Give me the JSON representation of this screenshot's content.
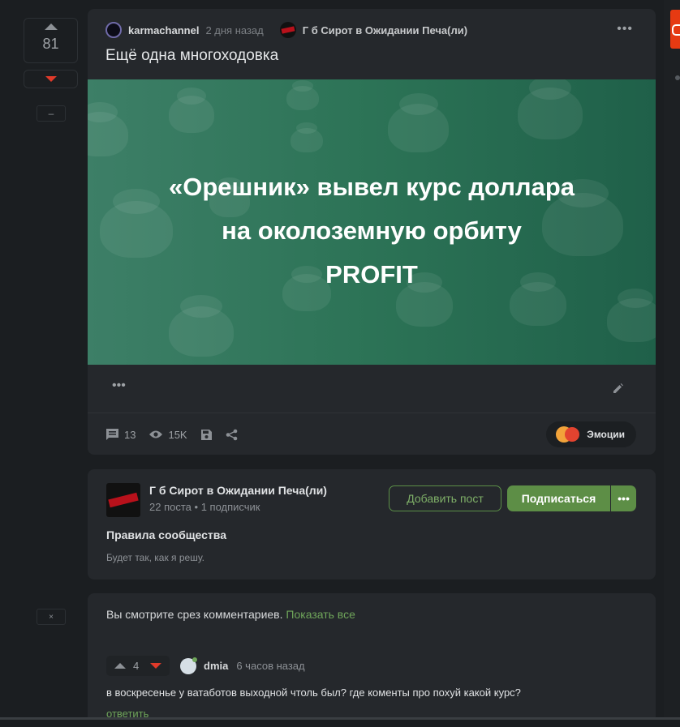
{
  "rail": {
    "rating": "81",
    "collapse_label": "–",
    "close_label": "×"
  },
  "post": {
    "author": "karmachannel",
    "time": "2 дня назад",
    "community": "Г б Сирот в Ожидании Печа(ли)",
    "title": "Ещё одна многоходовка",
    "banner_lines": [
      "«Орешник» вывел курс доллара",
      "на околоземную орбиту",
      "PROFIT"
    ],
    "comments_count": "13",
    "views": "15K",
    "emotions_label": "Эмоции"
  },
  "community": {
    "name": "Г б Сирот в Ожидании Печа(ли)",
    "posts": "22 поста",
    "subscribers": "1 подписчик",
    "add_post": "Добавить пост",
    "subscribe": "Подписаться",
    "rules_title": "Правила сообщества",
    "rules_text": "Будет так, как я решу."
  },
  "comments": {
    "slice_text": "Вы смотрите срез комментариев.",
    "show_all": "Показать все",
    "items": [
      {
        "score": "4",
        "user": "dmia",
        "time": "6 часов назад",
        "text": "в воскресенье у ватаботов выходной чтоль был? где коменты про похуй какой курс?",
        "reply": "ответить"
      }
    ]
  },
  "colors": {
    "accent_green": "#5d8e46",
    "downvote_red": "#e03a2a",
    "banner_green": "#2c7356"
  }
}
